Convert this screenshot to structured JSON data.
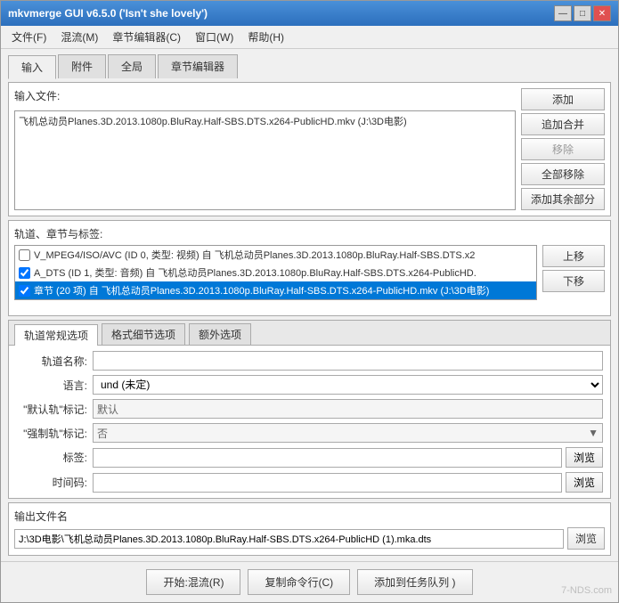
{
  "window": {
    "title": "mkvmerge GUI v6.5.0 ('Isn't she lovely')",
    "controls": {
      "minimize": "—",
      "restore": "□",
      "close": "✕"
    }
  },
  "menu": {
    "items": [
      "文件(F)",
      "混流(M)",
      "章节编辑器(C)",
      "窗口(W)",
      "帮助(H)"
    ]
  },
  "main_tabs": {
    "tabs": [
      "输入",
      "附件",
      "全局",
      "章节编辑器"
    ],
    "active": 0
  },
  "input_files": {
    "label": "输入文件:",
    "file": "飞机总动员Planes.3D.2013.1080p.BluRay.Half-SBS.DTS.x264-PublicHD.mkv (J:\\3D电影)",
    "buttons": {
      "add": "添加",
      "add_merge": "追加合并",
      "remove": "移除",
      "remove_all": "全部移除",
      "add_other": "添加其余部分"
    }
  },
  "tracks": {
    "label": "轨道、章节与标签:",
    "items": [
      {
        "checked": false,
        "text": "V_MPEG4/ISO/AVC (ID 0, 类型: 视频) 自 飞机总动员Planes.3D.2013.1080p.BluRay.Half-SBS.DTS.x2"
      },
      {
        "checked": true,
        "text": "A_DTS (ID 1, 类型: 音频) 自 飞机总动员Planes.3D.2013.1080p.BluRay.Half-SBS.DTS.x264-PublicHD."
      },
      {
        "checked": true,
        "text": "章节 (20 项) 自 飞机总动员Planes.3D.2013.1080p.BluRay.Half-SBS.DTS.x264-PublicHD.mkv (J:\\3D电影)"
      }
    ],
    "buttons": {
      "up": "上移",
      "down": "下移"
    }
  },
  "track_options": {
    "tabs": [
      "轨道常规选项",
      "格式细节选项",
      "额外选项"
    ],
    "active": 0,
    "track_name_label": "轨道名称:",
    "track_name_value": "",
    "language_label": "语言:",
    "language_value": "und (未定)",
    "default_flag_label": "\"默认轨\"标记:",
    "default_flag_value": "默认",
    "forced_flag_label": "\"强制轨\"标记:",
    "forced_flag_value": "否",
    "tags_label": "标签:",
    "tags_value": "",
    "tags_browse": "浏览",
    "timecodes_label": "时间码:",
    "timecodes_value": "",
    "timecodes_browse": "浏览"
  },
  "output": {
    "label": "输出文件名",
    "value": "J:\\3D电影\\飞机总动员Planes.3D.2013.1080p.BluRay.Half-SBS.DTS.x264-PublicHD (1).mka.dts",
    "browse": "浏览"
  },
  "bottom": {
    "start": "开始:混流(R)",
    "copy_cmd": "复制命令行(C)",
    "add_queue": "添加到任务队列 )"
  },
  "watermark": "7-NDS.com"
}
